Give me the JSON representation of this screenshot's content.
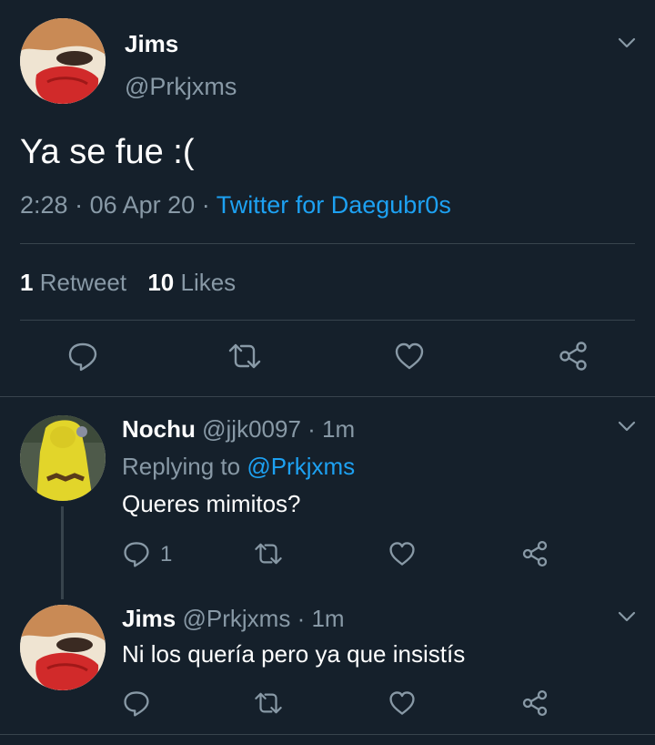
{
  "main_tweet": {
    "author_name": "Jims",
    "author_handle": "@Prkjxms",
    "text": "Ya se fue :(",
    "time": "2:28",
    "date": "06 Apr 20",
    "separator": "·",
    "source": "Twitter for Daegubr0s",
    "retweet_count": "1",
    "retweet_label": "Retweet",
    "likes_count": "10",
    "likes_label": "Likes"
  },
  "replies": [
    {
      "author_name": "Nochu",
      "author_handle": "@jjk0097",
      "time": "· 1m",
      "replying_label": "Replying to",
      "replying_handle": "@Prkjxms",
      "text": "Queres mimitos?",
      "reply_count": "1"
    },
    {
      "author_name": "Jims",
      "author_handle": "@Prkjxms",
      "time": "· 1m",
      "text": "Ni los quería pero ya que insistís"
    }
  ],
  "icons": [
    "reply-icon",
    "retweet-icon",
    "like-icon",
    "share-icon",
    "chevron-down-icon"
  ],
  "colors": {
    "background": "#15202b",
    "text": "#ffffff",
    "muted": "#8899a6",
    "accent": "#1da1f2",
    "divider": "#38444d"
  }
}
